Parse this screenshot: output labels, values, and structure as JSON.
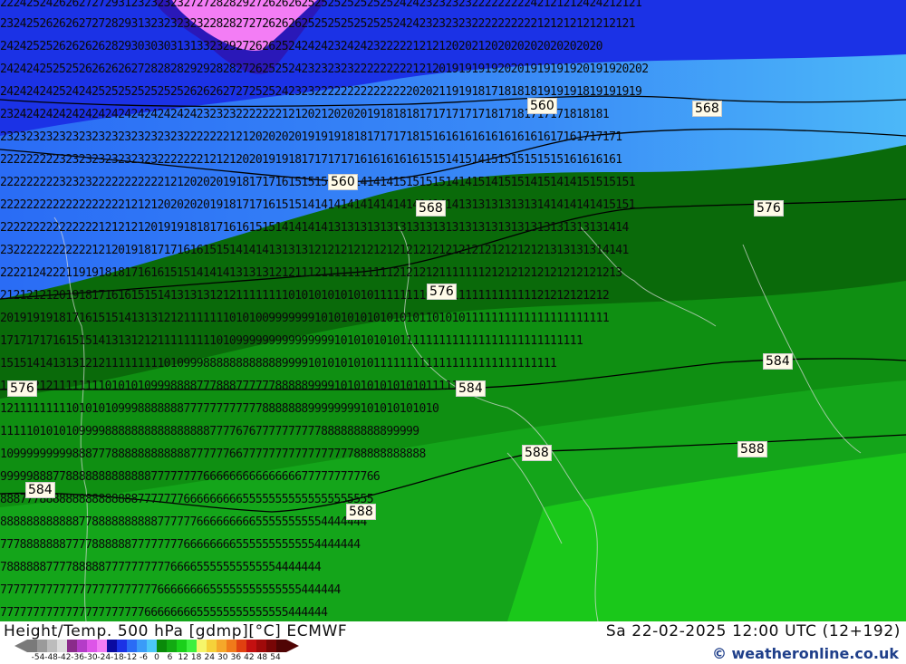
{
  "map": {
    "rows": [
      "22242524262627272931232323232727282829272626262525252525252524242323232322222222242121212424212121",
      "2324252626262727282931323232323228282727262626252525252525252424232323232222222222121212121212121",
      "24242525262626262829303030313133232927262625242424232424232222212121202021202020202020202020",
      "242424252525262626262728282829292828272625252423232323222222222121201919191920201919191920191920202",
      "24242424252424252525252525252626262727252524232322222222222222202021191918171818181919191819191919",
      "232424242424242424242424242424232323222222212120212020201918181817171717171817181717171818181",
      "23232323232323232323232323232222222121202020201919191818171717181516161616161616161617161717171",
      "22222222232323232323232322222221212120201919181717171716161616161515141514151515151515161616161",
      "2222222223232322222222222121202020191817171615151515151414141515151514141514151514151414151515151",
      "2222222222222222222121212020202019181717161515141414141414141414141414131313131313141414141415151",
      "222222222222222121212120191918181716161515141414141313131313131313131313131313131313131313131414",
      "232222222222221212019181717161615151414141313131212121212121212121212121212121212121313131314141",
      "22221242221191918181716161515141414131313121211121111111111121212121111111212121212121212121213",
      "212121212019181716161515141313131212111111110101010101010111111110111111111111111121212121212",
      "201919191817161515141313121211111110101009999999101010101010101011010101111111111111111111111",
      "17171717161515141313121211111111101099999999999999910101010101111111111111111111111111111",
      "1515141413131212111111111010999888888888888999910101010101111111111111111111111111111",
      "131212121111111101010109998888777888777777888889999101010101010101111111",
      "1211111111101010109998888888777777777777888888899999999101010101010",
      "1111101010109999888888888888888877776767777777777888888888899999",
      "10999999999888777888888888888777777667777777777777777788888888888",
      "9999988877888888888888877777777666666666666666777777777766",
      "888777888888888888888777777766666666655555555555555555555",
      "88888888888877888888888877777766666666655555555554444444",
      "7778888888777788888877777777666666665555555555554444444",
      "7888888777788888777777777766665555555555554444444",
      "7777777777777777777777776666666655555555555555444444",
      "77777777777777777777776666666655555555555555444444"
    ],
    "contour_labels": [
      "560",
      "568",
      "560",
      "568",
      "576",
      "576",
      "576",
      "584",
      "584",
      "588",
      "588",
      "584",
      "588"
    ]
  },
  "footer": {
    "title": "Height/Temp. 500 hPa [gdmp][°C] ECMWF",
    "datetime": "Sa 22-02-2025 12:00 UTC (12+192)",
    "credit": "© weatheronline.co.uk"
  },
  "legend": {
    "labels": [
      "-54",
      "-48",
      "-42",
      "-36",
      "-30",
      "-24",
      "-18",
      "-12",
      "-6",
      "0",
      "6",
      "12",
      "18",
      "24",
      "30",
      "36",
      "42",
      "48",
      "54"
    ],
    "colors": [
      "#7a7a7a",
      "#9a9a9a",
      "#bcbcbc",
      "#dcdcdc",
      "#8a2b8a",
      "#b43cc8",
      "#dd55e8",
      "#f37df5",
      "#0a0aa0",
      "#1b32e6",
      "#2a6cf5",
      "#3a9cf8",
      "#4cc8f8",
      "#0a8a0a",
      "#12aa12",
      "#1ad01a",
      "#3ef03e",
      "#f5f56a",
      "#f5d23a",
      "#f5a82a",
      "#f07a1a",
      "#e04010",
      "#c41010",
      "#a00a0a",
      "#780606",
      "#500404"
    ]
  }
}
